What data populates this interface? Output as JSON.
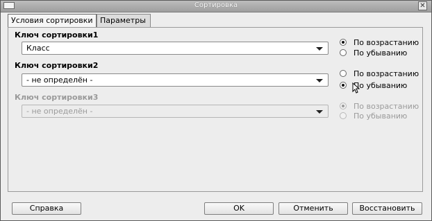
{
  "window": {
    "title": "Сортировка",
    "close_glyph": "✕"
  },
  "tabs": [
    {
      "label": "Условия сортировки",
      "active": true
    },
    {
      "label": "Параметры",
      "active": false
    }
  ],
  "keys": [
    {
      "label": "Ключ сортировки1",
      "value": "Класс",
      "enabled": true,
      "ascending_label": "По возрастанию",
      "descending_label": "По убыванию",
      "selected": "ascending"
    },
    {
      "label": "Ключ сортировки2",
      "value": "- не определён -",
      "enabled": true,
      "ascending_label": "По возрастанию",
      "descending_label": "По убыванию",
      "selected": "descending"
    },
    {
      "label": "Ключ сортировки3",
      "value": "- не определён -",
      "enabled": false,
      "ascending_label": "По возрастанию",
      "descending_label": "По убыванию",
      "selected": "ascending"
    }
  ],
  "buttons": {
    "help": "Справка",
    "ok": "OK",
    "cancel": "Отменить",
    "reset": "Восстановить"
  }
}
